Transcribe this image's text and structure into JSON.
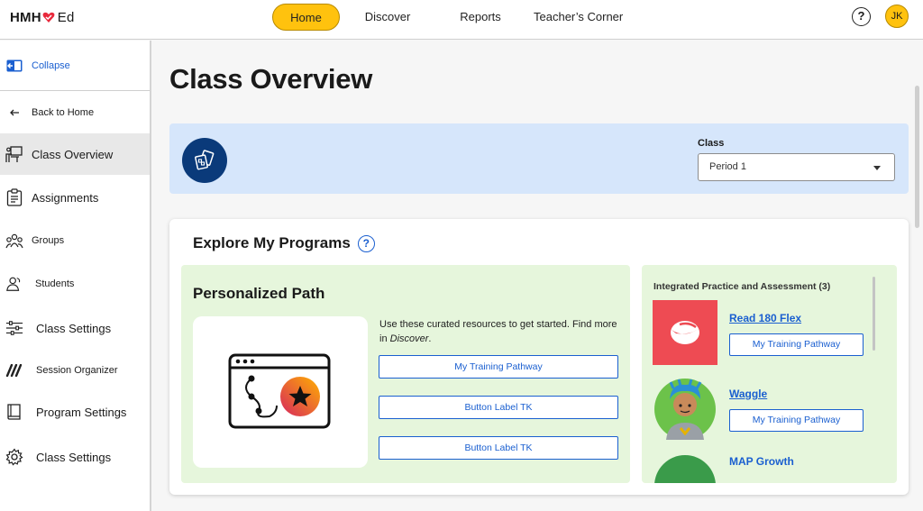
{
  "brand": {
    "hmh": "HMH",
    "ed": "Ed",
    "accent": "#e8293c"
  },
  "nav": {
    "home": "Home",
    "discover": "Discover",
    "reports": "Reports",
    "teachers_corner": "Teacher’s Corner",
    "help": "?",
    "avatar_initials": "JK",
    "active_color": "#ffc20e"
  },
  "sidebar": {
    "collapse": "Collapse",
    "items": [
      {
        "label": "Back to Home",
        "icon": "back-arrow-icon"
      },
      {
        "label": "Class Overview",
        "icon": "classroom-icon",
        "active": true
      },
      {
        "label": "Assignments",
        "icon": "clipboard-icon"
      },
      {
        "label": "Groups",
        "icon": "groups-icon"
      },
      {
        "label": "Students",
        "icon": "students-icon"
      },
      {
        "label": "Class Settings",
        "icon": "sliders-icon"
      },
      {
        "label": "Session Organizer",
        "icon": "session-organizer-icon"
      },
      {
        "label": "Program Settings",
        "icon": "book-icon"
      },
      {
        "label": "Class Settings",
        "icon": "gear-icon"
      }
    ]
  },
  "main": {
    "title": "Class Overview",
    "class_selector": {
      "label": "Class",
      "value": "Period 1"
    },
    "programs": {
      "title": "Explore My Programs",
      "help": "?",
      "personalized_path": {
        "title": "Personalized Path",
        "description_prefix": "Use these curated resources to get started. Find more in ",
        "description_link": "Discover",
        "description_suffix": ".",
        "buttons": [
          "My Training Pathway",
          "Button Label TK",
          "Button Label TK"
        ]
      },
      "integrated": {
        "title": "Integrated Practice and Assessment (3)",
        "items": [
          {
            "name": "Read 180 Flex",
            "button": "My Training Pathway"
          },
          {
            "name": "Waggle",
            "button": "My Training Pathway"
          },
          {
            "name": "MAP Growth"
          }
        ]
      }
    }
  }
}
